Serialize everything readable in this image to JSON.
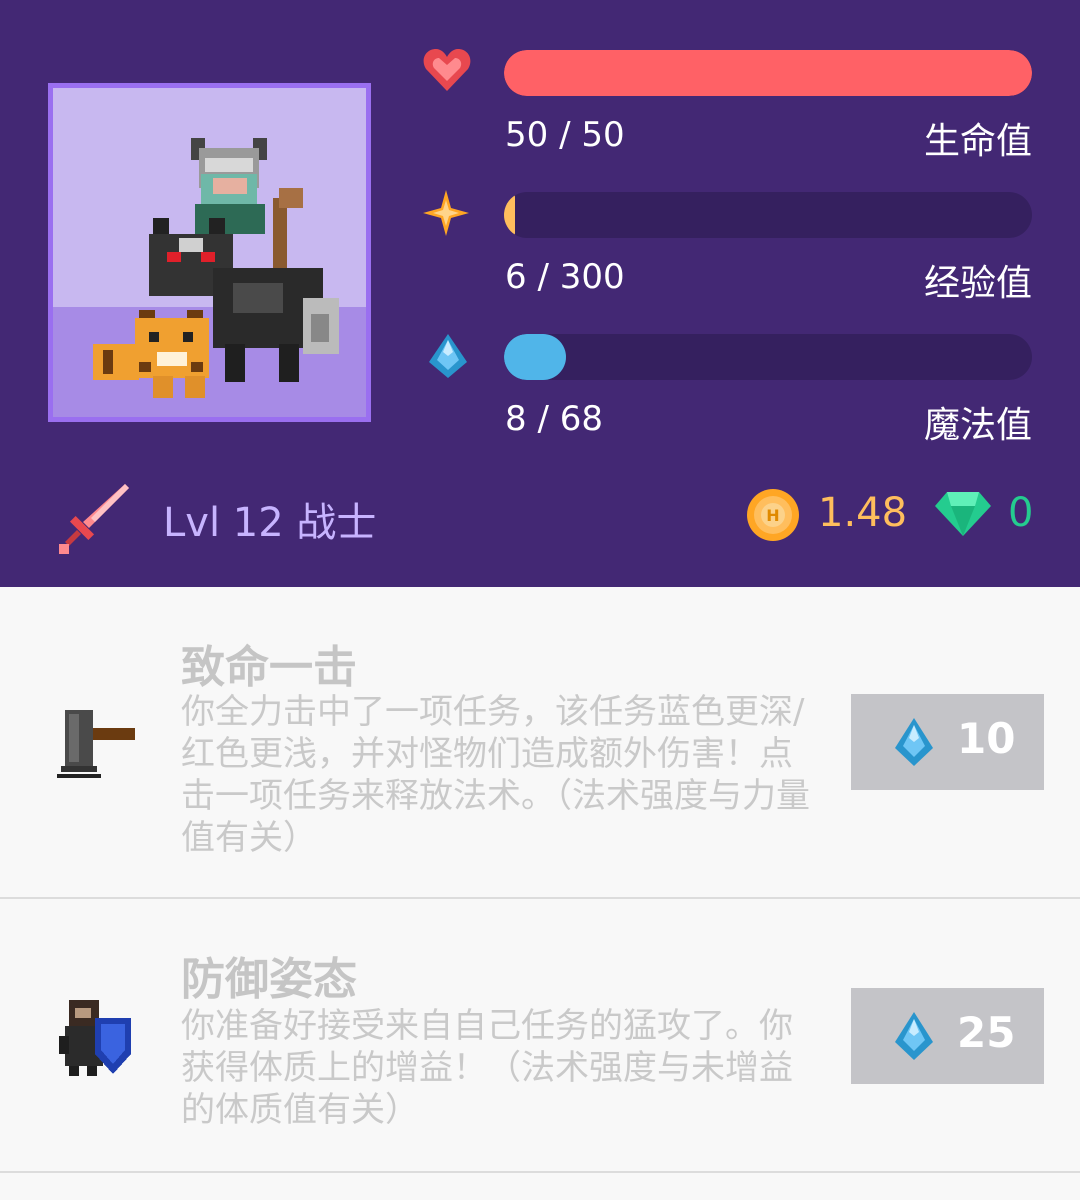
{
  "colors": {
    "header_bg": "#432874",
    "health": "#ff6166",
    "experience": "#ffbe5d",
    "mana": "#50b5e9",
    "bar_track": "#35205f"
  },
  "stats": {
    "health": {
      "icon": "heart-icon",
      "value_text": "50 / 50",
      "label": "生命值",
      "current": 50,
      "max": 50
    },
    "experience": {
      "icon": "star-icon",
      "value_text": "6 / 300",
      "label": "经验值",
      "current": 6,
      "max": 300
    },
    "mana": {
      "icon": "mana-drop-icon",
      "value_text": "8 / 68",
      "label": "魔法值",
      "current": 8,
      "max": 68
    }
  },
  "profile": {
    "class_icon": "sword-icon",
    "level_text": "Lvl 12 战士",
    "gold": "1.48",
    "gems": "0"
  },
  "skills": [
    {
      "icon": "hammer-icon",
      "title": "致命一击",
      "description": "你全力击中了一项任务，该任务蓝色更深/红色更浅，并对怪物们造成额外伤害！点击一项任务来释放法术。（法术强度与力量值有关）",
      "cost": "10"
    },
    {
      "icon": "shield-knight-icon",
      "title": "防御姿态",
      "description": "你准备好接受来自自己任务的猛攻了。你获得体质上的增益！（法术强度与未增益的体质值有关）",
      "cost": "25"
    }
  ]
}
